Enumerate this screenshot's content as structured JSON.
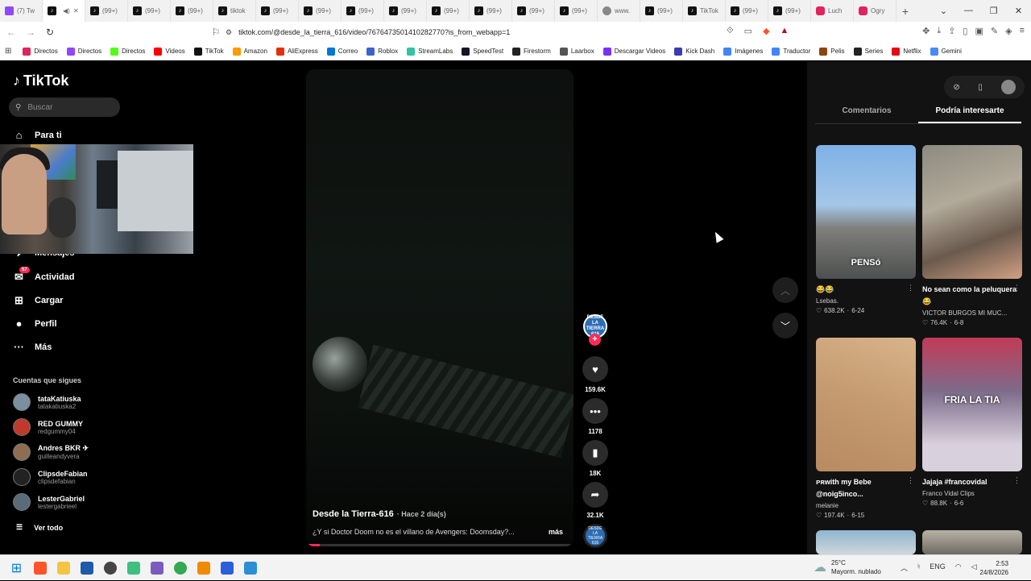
{
  "browser": {
    "tabs": [
      {
        "label": "(7) Tw",
        "icon": "twitch-icon"
      },
      {
        "label": "",
        "icon": "tiktok-icon",
        "active": true
      },
      {
        "label": "(99+)",
        "icon": "tiktok-icon"
      },
      {
        "label": "(99+)",
        "icon": "tiktok-icon"
      },
      {
        "label": "(99+)",
        "icon": "tiktok-icon"
      },
      {
        "label": "tiktok",
        "icon": "tiktok-icon"
      },
      {
        "label": "(99+)",
        "icon": "tiktok-icon"
      },
      {
        "label": "(99+)",
        "icon": "tiktok-icon"
      },
      {
        "label": "(99+)",
        "icon": "tiktok-icon"
      },
      {
        "label": "(99+)",
        "icon": "tiktok-icon"
      },
      {
        "label": "(99+)",
        "icon": "tiktok-icon"
      },
      {
        "label": "(99+)",
        "icon": "tiktok-icon"
      },
      {
        "label": "(99+)",
        "icon": "tiktok-icon"
      },
      {
        "label": "(99+)",
        "icon": "tiktok-icon"
      },
      {
        "label": "www.",
        "icon": "globe-icon"
      },
      {
        "label": "(99+)",
        "icon": "tiktok-icon"
      },
      {
        "label": "TikTok",
        "icon": "tiktok-icon"
      },
      {
        "label": "(99+)",
        "icon": "tiktok-icon"
      },
      {
        "label": "(99+)",
        "icon": "tiktok-icon"
      },
      {
        "label": "Luch",
        "icon": "youtube-icon"
      },
      {
        "label": "Ogry",
        "icon": "youtube-icon"
      }
    ],
    "url": "tiktok.com/@desde_la_tierra_616/video/7676473501410282770?is_from_webapp=1",
    "bookmarks": [
      {
        "label": "Directos",
        "color": "#e0245e"
      },
      {
        "label": "Directos",
        "color": "#9146ff"
      },
      {
        "label": "Directos",
        "color": "#53fc18"
      },
      {
        "label": "Videos",
        "color": "#ff0000"
      },
      {
        "label": "TikTok",
        "color": "#111111"
      },
      {
        "label": "Amazon",
        "color": "#ff9900"
      },
      {
        "label": "AliExpress",
        "color": "#e62e04"
      },
      {
        "label": "Correo",
        "color": "#0078d4"
      },
      {
        "label": "Roblox",
        "color": "#3a64c8"
      },
      {
        "label": "StreamLabs",
        "color": "#31c3a2"
      },
      {
        "label": "SpeedTest",
        "color": "#141526"
      },
      {
        "label": "Firestorm",
        "color": "#222222"
      },
      {
        "label": "Laarbox",
        "color": "#555555"
      },
      {
        "label": "Descargar Videos",
        "color": "#7b2ff7"
      },
      {
        "label": "Kick Dash",
        "color": "#3b3bb3"
      },
      {
        "label": "Imágenes",
        "color": "#4285f4"
      },
      {
        "label": "Traductor",
        "color": "#4285f4"
      },
      {
        "label": "Pelis",
        "color": "#8b4513"
      },
      {
        "label": "Series",
        "color": "#222222"
      },
      {
        "label": "Netflix",
        "color": "#e50914"
      },
      {
        "label": "Gemini",
        "color": "#4a8af4"
      }
    ]
  },
  "sidebar": {
    "logo": "TikTok",
    "search_placeholder": "Buscar",
    "nav": [
      {
        "label": "Para ti",
        "icon": "home-icon"
      },
      {
        "label": "Mensajes",
        "icon": "messages-icon"
      },
      {
        "label": "Actividad",
        "icon": "activity-icon",
        "badge": "57"
      },
      {
        "label": "Cargar",
        "icon": "upload-icon"
      },
      {
        "label": "Perfil",
        "icon": "profile-icon"
      },
      {
        "label": "Más",
        "icon": "more-icon"
      }
    ],
    "following_title": "Cuentas que sigues",
    "following": [
      {
        "name": "tataKatiuska",
        "user": "tatakatiuska2"
      },
      {
        "name": "RED GUMMY",
        "user": "redgummy04"
      },
      {
        "name": "Andres BKR ✈",
        "user": "guilleandyvera"
      },
      {
        "name": "ClipsdeFabian",
        "user": "clipsdefabian"
      },
      {
        "name": "LesterGabriel",
        "user": "lestergabrieel"
      }
    ],
    "see_all": "Ver todo"
  },
  "video": {
    "author": "Desde la Tierra-616",
    "ago": "· Hace 2 día(s)",
    "description": "¿Y si Doctor Doom no es el villano de Avengers: Doomsday?...",
    "more": "más",
    "progress": 0.05,
    "avatar_text": "DESDE LA TIERRA 616"
  },
  "actions": {
    "likes": "159.6K",
    "comments": "1178",
    "saves": "18K",
    "shares": "32.1K"
  },
  "right_panel": {
    "tabs": [
      "Comentarios",
      "Podría interesarte"
    ],
    "active_tab": 1,
    "cards": [
      {
        "title": "😂😂",
        "author": "Lsebas.",
        "likes": "638.2K",
        "date": "6-24",
        "overlay": "PENSó"
      },
      {
        "title": "No sean como la peluquera 😂",
        "author": "VICTOR BURGOS MI MUC...",
        "likes": "76.4K",
        "date": "6-8",
        "overlay": ""
      },
      {
        "title": "ᴘʀwith my Bebe @noig5inco...",
        "author": "melanie",
        "likes": "197.4K",
        "date": "6-15",
        "overlay": ""
      },
      {
        "title": "Jajaja #francovidal",
        "author": "Franco Vidal Clips",
        "likes": "88.8K",
        "date": "6-6",
        "overlay": "FRIA LA TIA"
      }
    ]
  },
  "taskbar": {
    "temp": "25°C",
    "weather": "Mayorm. nublado",
    "lang": "ENG",
    "time": "2:53",
    "date": "24/8/2026"
  }
}
